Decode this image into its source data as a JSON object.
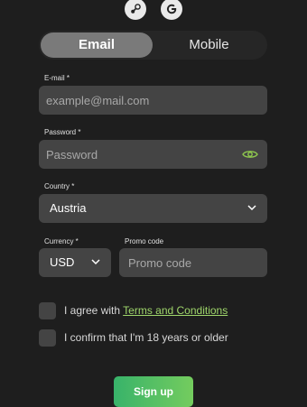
{
  "social": {
    "icons": [
      "steam-icon",
      "google-icon"
    ]
  },
  "tabs": {
    "email": "Email",
    "mobile": "Mobile",
    "active": "Email"
  },
  "email": {
    "label": "E-mail *",
    "placeholder": "example@mail.com"
  },
  "password": {
    "label": "Password *",
    "placeholder": "Password",
    "toggle_icon": "eye-icon"
  },
  "country": {
    "label": "Country *",
    "value": "Austria"
  },
  "currency": {
    "label": "Currency *",
    "value": "USD"
  },
  "promo": {
    "label": "Promo code",
    "placeholder": "Promo code"
  },
  "agree": {
    "prefix": "I agree with ",
    "link": "Terms and Conditions"
  },
  "age": {
    "text": "I confirm that I'm 18 years or older"
  },
  "signup": {
    "label": "Sign up"
  },
  "colors": {
    "background": "#1e1e1e",
    "field": "#444444",
    "accent_link": "#9fd66b",
    "button_gradient_start": "#38b36a",
    "button_gradient_end": "#74cc5e",
    "eye_icon": "#8fc84e"
  }
}
